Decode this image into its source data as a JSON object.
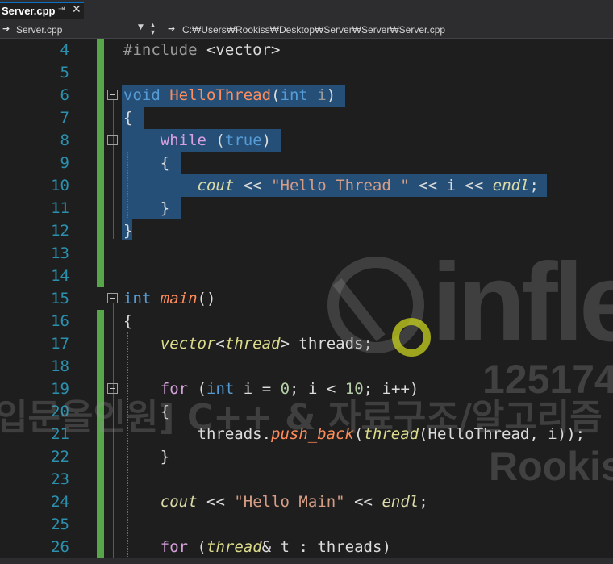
{
  "tab": {
    "title": "Server.cpp",
    "pin_icon": "pin-icon",
    "close_icon": "close-icon"
  },
  "nav": {
    "scope": "Server.cpp",
    "path": "C:₩Users₩Rookiss₩Desktop₩Server₩Server₩Server.cpp"
  },
  "colors": {
    "keyword": "#569cd6",
    "control": "#d8a0df",
    "function": "#ff8c5a",
    "type": "#dcdc8b",
    "string": "#d69d85",
    "line_number": "#2b91af",
    "selection": "#264f78",
    "change_bar": "#57a64a"
  },
  "editor": {
    "lines": [
      {
        "num": "4",
        "text": "#include <vector>"
      },
      {
        "num": "5",
        "text": ""
      },
      {
        "num": "6",
        "text": "void HelloThread(int i)"
      },
      {
        "num": "7",
        "text": "{"
      },
      {
        "num": "8",
        "text": "    while (true)"
      },
      {
        "num": "9",
        "text": "    {"
      },
      {
        "num": "10",
        "text": "        cout << \"Hello Thread \" << i << endl;"
      },
      {
        "num": "11",
        "text": "    }"
      },
      {
        "num": "12",
        "text": "}"
      },
      {
        "num": "13",
        "text": ""
      },
      {
        "num": "14",
        "text": ""
      },
      {
        "num": "15",
        "text": "int main()"
      },
      {
        "num": "16",
        "text": "{"
      },
      {
        "num": "17",
        "text": "    vector<thread> threads;"
      },
      {
        "num": "18",
        "text": ""
      },
      {
        "num": "19",
        "text": "    for (int i = 0; i < 10; i++)"
      },
      {
        "num": "20",
        "text": "    {"
      },
      {
        "num": "21",
        "text": "        threads.push_back(thread(HelloThread, i));"
      },
      {
        "num": "22",
        "text": "    }"
      },
      {
        "num": "23",
        "text": ""
      },
      {
        "num": "24",
        "text": "    cout << \"Hello Main\" << endl;"
      },
      {
        "num": "25",
        "text": ""
      },
      {
        "num": "26",
        "text": "    for (thread& t : threads)"
      }
    ]
  },
  "watermark": {
    "brand": "inflea",
    "id": "125174",
    "course": "입문올인원] C++ & 자료구조/알고리즘",
    "author": "Rookiss"
  }
}
